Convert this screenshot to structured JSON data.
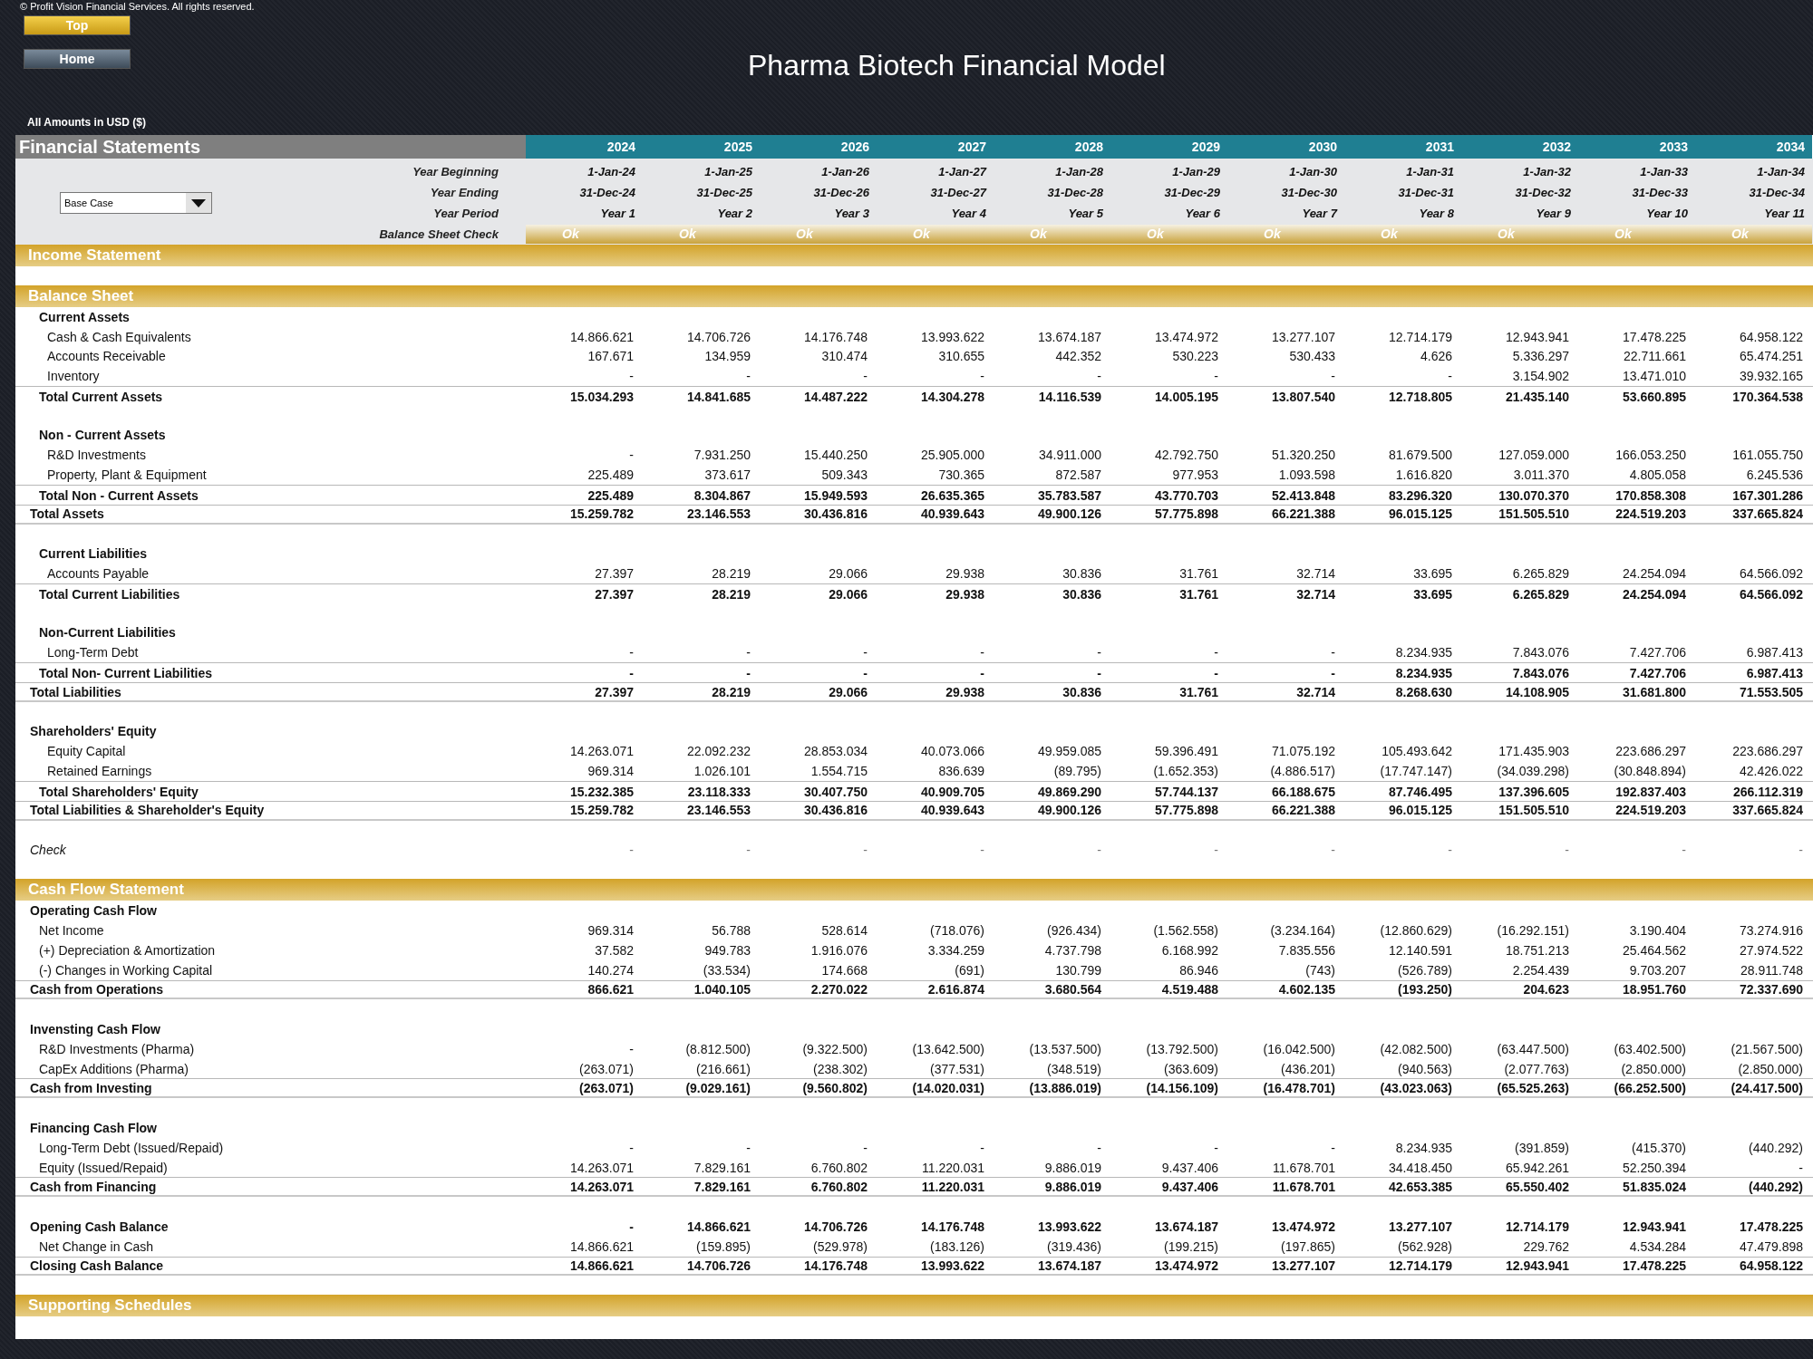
{
  "copyright": "© Profit Vision Financial Services. All rights reserved.",
  "buttons": [
    {
      "label": "Top",
      "kind": "gold"
    },
    {
      "label": "Home",
      "kind": "slate"
    }
  ],
  "title": "Pharma Biotech Financial Model",
  "currency_note": "All Amounts in USD ($)",
  "sheet_title": "Financial Statements",
  "years": [
    "2024",
    "2025",
    "2026",
    "2027",
    "2028",
    "2029",
    "2030",
    "2031",
    "2032",
    "2033",
    "2034"
  ],
  "scenario": {
    "value": "Base Case"
  },
  "info_rows": [
    {
      "label": "Year Beginning",
      "values": [
        "1-Jan-24",
        "1-Jan-25",
        "1-Jan-26",
        "1-Jan-27",
        "1-Jan-28",
        "1-Jan-29",
        "1-Jan-30",
        "1-Jan-31",
        "1-Jan-32",
        "1-Jan-33",
        "1-Jan-34"
      ]
    },
    {
      "label": "Year Ending",
      "values": [
        "31-Dec-24",
        "31-Dec-25",
        "31-Dec-26",
        "31-Dec-27",
        "31-Dec-28",
        "31-Dec-29",
        "31-Dec-30",
        "31-Dec-31",
        "31-Dec-32",
        "31-Dec-33",
        "31-Dec-34"
      ]
    },
    {
      "label": "Year Period",
      "values": [
        "Year 1",
        "Year 2",
        "Year 3",
        "Year 4",
        "Year 5",
        "Year 6",
        "Year 7",
        "Year 8",
        "Year 9",
        "Year 10",
        "Year 11"
      ]
    }
  ],
  "balance_check": {
    "label": "Balance Sheet Check",
    "values": [
      "Ok",
      "Ok",
      "Ok",
      "Ok",
      "Ok",
      "Ok",
      "Ok",
      "Ok",
      "Ok",
      "Ok",
      "Ok"
    ]
  },
  "sections": [
    {
      "title": "Income Statement",
      "gap_before": false
    },
    {
      "title": "Balance Sheet",
      "gap_before": true,
      "rows": [
        {
          "kind": "group",
          "label": "Current Assets",
          "gap_before": false
        },
        {
          "kind": "item",
          "label": "Cash & Cash Equivalents",
          "gap_before": false,
          "values": [
            "14.866.621",
            "14.706.726",
            "14.176.748",
            "13.993.622",
            "13.674.187",
            "13.474.972",
            "13.277.107",
            "12.714.179",
            "12.943.941",
            "17.478.225",
            "64.958.122"
          ]
        },
        {
          "kind": "item",
          "label": "Accounts Receivable",
          "gap_before": false,
          "values": [
            "167.671",
            "134.959",
            "310.474",
            "310.655",
            "442.352",
            "530.223",
            "530.433",
            "4.626",
            "5.336.297",
            "22.711.661",
            "65.474.251"
          ]
        },
        {
          "kind": "item",
          "label": "Inventory",
          "gap_before": false,
          "values": [
            "-",
            "-",
            "-",
            "-",
            "-",
            "-",
            "-",
            "-",
            "3.154.902",
            "13.471.010",
            "39.932.165"
          ]
        },
        {
          "kind": "subtotal",
          "label": "Total Current Assets",
          "gap_before": false,
          "values": [
            "15.034.293",
            "14.841.685",
            "14.487.222",
            "14.304.278",
            "14.116.539",
            "14.005.195",
            "13.807.540",
            "12.718.805",
            "21.435.140",
            "53.660.895",
            "170.364.538"
          ]
        },
        {
          "kind": "group",
          "label": "Non - Current Assets",
          "gap_before": true
        },
        {
          "kind": "item",
          "label": "R&D Investments",
          "gap_before": false,
          "values": [
            "-",
            "7.931.250",
            "15.440.250",
            "25.905.000",
            "34.911.000",
            "42.792.750",
            "51.320.250",
            "81.679.500",
            "127.059.000",
            "166.053.250",
            "161.055.750"
          ]
        },
        {
          "kind": "item",
          "label": "Property, Plant & Equipment",
          "gap_before": false,
          "values": [
            "225.489",
            "373.617",
            "509.343",
            "730.365",
            "872.587",
            "977.953",
            "1.093.598",
            "1.616.820",
            "3.011.370",
            "4.805.058",
            "6.245.536"
          ]
        },
        {
          "kind": "subtotal",
          "label": "Total Non - Current Assets",
          "gap_before": false,
          "values": [
            "225.489",
            "8.304.867",
            "15.949.593",
            "26.635.365",
            "35.783.587",
            "43.770.703",
            "52.413.848",
            "83.296.320",
            "130.070.370",
            "170.858.308",
            "167.301.286"
          ]
        },
        {
          "kind": "total",
          "label": "Total Assets",
          "gap_before": false,
          "values": [
            "15.259.782",
            "23.146.553",
            "30.436.816",
            "40.939.643",
            "49.900.126",
            "57.775.898",
            "66.221.388",
            "96.015.125",
            "151.505.510",
            "224.519.203",
            "337.665.824"
          ]
        },
        {
          "kind": "group",
          "label": "Current Liabilities",
          "gap_before": true
        },
        {
          "kind": "item",
          "label": "Accounts Payable",
          "gap_before": false,
          "values": [
            "27.397",
            "28.219",
            "29.066",
            "29.938",
            "30.836",
            "31.761",
            "32.714",
            "33.695",
            "6.265.829",
            "24.254.094",
            "64.566.092"
          ]
        },
        {
          "kind": "subtotal",
          "label": "Total Current Liabilities",
          "gap_before": false,
          "values": [
            "27.397",
            "28.219",
            "29.066",
            "29.938",
            "30.836",
            "31.761",
            "32.714",
            "33.695",
            "6.265.829",
            "24.254.094",
            "64.566.092"
          ]
        },
        {
          "kind": "group",
          "label": "Non-Current Liabilities",
          "gap_before": true
        },
        {
          "kind": "item",
          "label": "Long-Term Debt",
          "gap_before": false,
          "values": [
            "-",
            "-",
            "-",
            "-",
            "-",
            "-",
            "-",
            "8.234.935",
            "7.843.076",
            "7.427.706",
            "6.987.413"
          ]
        },
        {
          "kind": "subtotal",
          "label": "Total Non- Current Liabilities",
          "gap_before": false,
          "values": [
            "-",
            "-",
            "-",
            "-",
            "-",
            "-",
            "-",
            "8.234.935",
            "7.843.076",
            "7.427.706",
            "6.987.413"
          ]
        },
        {
          "kind": "total",
          "label": "Total Liabilities",
          "gap_before": false,
          "values": [
            "27.397",
            "28.219",
            "29.066",
            "29.938",
            "30.836",
            "31.761",
            "32.714",
            "8.268.630",
            "14.108.905",
            "31.681.800",
            "71.553.505"
          ]
        },
        {
          "kind": "heading",
          "label": "Shareholders' Equity",
          "gap_before": true
        },
        {
          "kind": "item",
          "label": "Equity Capital",
          "gap_before": false,
          "values": [
            "14.263.071",
            "22.092.232",
            "28.853.034",
            "40.073.066",
            "49.959.085",
            "59.396.491",
            "71.075.192",
            "105.493.642",
            "171.435.903",
            "223.686.297",
            "223.686.297"
          ]
        },
        {
          "kind": "item",
          "label": "Retained Earnings",
          "gap_before": false,
          "values": [
            "969.314",
            "1.026.101",
            "1.554.715",
            "836.639",
            "(89.795)",
            "(1.652.353)",
            "(4.886.517)",
            "(17.747.147)",
            "(34.039.298)",
            "(30.848.894)",
            "42.426.022"
          ]
        },
        {
          "kind": "subtotal",
          "label": "Total Shareholders' Equity",
          "gap_before": false,
          "values": [
            "15.232.385",
            "23.118.333",
            "30.407.750",
            "40.909.705",
            "49.869.290",
            "57.744.137",
            "66.188.675",
            "87.746.495",
            "137.396.605",
            "192.837.403",
            "266.112.319"
          ]
        },
        {
          "kind": "total",
          "label": "Total Liabilities & Shareholder's Equity",
          "gap_before": false,
          "values": [
            "15.259.782",
            "23.146.553",
            "30.436.816",
            "40.939.643",
            "49.900.126",
            "57.775.898",
            "66.221.388",
            "96.015.125",
            "151.505.510",
            "224.519.203",
            "337.665.824"
          ]
        },
        {
          "kind": "check",
          "label": "Check",
          "gap_before": true,
          "values": [
            "-",
            "-",
            "-",
            "-",
            "-",
            "-",
            "-",
            "-",
            "-",
            "-",
            "-"
          ]
        }
      ]
    },
    {
      "title": "Cash Flow Statement",
      "gap_before": true,
      "rows": [
        {
          "kind": "heading",
          "label": "Operating Cash Flow",
          "gap_before": false
        },
        {
          "kind": "line",
          "label": "Net Income",
          "gap_before": false,
          "values": [
            "969.314",
            "56.788",
            "528.614",
            "(718.076)",
            "(926.434)",
            "(1.562.558)",
            "(3.234.164)",
            "(12.860.629)",
            "(16.292.151)",
            "3.190.404",
            "73.274.916"
          ]
        },
        {
          "kind": "line",
          "label": "(+) Depreciation & Amortization",
          "gap_before": false,
          "values": [
            "37.582",
            "949.783",
            "1.916.076",
            "3.334.259",
            "4.737.798",
            "6.168.992",
            "7.835.556",
            "12.140.591",
            "18.751.213",
            "25.464.562",
            "27.974.522"
          ]
        },
        {
          "kind": "line",
          "label": "(-) Changes in Working Capital",
          "gap_before": false,
          "values": [
            "140.274",
            "(33.534)",
            "174.668",
            "(691)",
            "130.799",
            "86.946",
            "(743)",
            "(526.789)",
            "2.254.439",
            "9.703.207",
            "28.911.748"
          ]
        },
        {
          "kind": "total",
          "label": "Cash from Operations",
          "gap_before": false,
          "values": [
            "866.621",
            "1.040.105",
            "2.270.022",
            "2.616.874",
            "3.680.564",
            "4.519.488",
            "4.602.135",
            "(193.250)",
            "204.623",
            "18.951.760",
            "72.337.690"
          ]
        },
        {
          "kind": "heading",
          "label": "Invensting Cash Flow",
          "gap_before": true
        },
        {
          "kind": "line",
          "label": "R&D Investments (Pharma)",
          "gap_before": false,
          "values": [
            "-",
            "(8.812.500)",
            "(9.322.500)",
            "(13.642.500)",
            "(13.537.500)",
            "(13.792.500)",
            "(16.042.500)",
            "(42.082.500)",
            "(63.447.500)",
            "(63.402.500)",
            "(21.567.500)"
          ]
        },
        {
          "kind": "line",
          "label": "CapEx Additions (Pharma)",
          "gap_before": false,
          "values": [
            "(263.071)",
            "(216.661)",
            "(238.302)",
            "(377.531)",
            "(348.519)",
            "(363.609)",
            "(436.201)",
            "(940.563)",
            "(2.077.763)",
            "(2.850.000)",
            "(2.850.000)"
          ]
        },
        {
          "kind": "total",
          "label": "Cash from Investing",
          "gap_before": false,
          "values": [
            "(263.071)",
            "(9.029.161)",
            "(9.560.802)",
            "(14.020.031)",
            "(13.886.019)",
            "(14.156.109)",
            "(16.478.701)",
            "(43.023.063)",
            "(65.525.263)",
            "(66.252.500)",
            "(24.417.500)"
          ]
        },
        {
          "kind": "heading",
          "label": "Financing Cash Flow",
          "gap_before": true
        },
        {
          "kind": "line",
          "label": "Long-Term Debt (Issued/Repaid)",
          "gap_before": false,
          "values": [
            "-",
            "-",
            "-",
            "-",
            "-",
            "-",
            "-",
            "8.234.935",
            "(391.859)",
            "(415.370)",
            "(440.292)"
          ]
        },
        {
          "kind": "line",
          "label": "Equity (Issued/Repaid)",
          "gap_before": false,
          "values": [
            "14.263.071",
            "7.829.161",
            "6.760.802",
            "11.220.031",
            "9.886.019",
            "9.437.406",
            "11.678.701",
            "34.418.450",
            "65.942.261",
            "52.250.394",
            "-"
          ]
        },
        {
          "kind": "total",
          "label": "Cash from Financing",
          "gap_before": false,
          "values": [
            "14.263.071",
            "7.829.161",
            "6.760.802",
            "11.220.031",
            "9.886.019",
            "9.437.406",
            "11.678.701",
            "42.653.385",
            "65.550.402",
            "51.835.024",
            "(440.292)"
          ]
        },
        {
          "kind": "heading",
          "label": "Opening Cash Balance",
          "gap_before": true,
          "values": [
            "-",
            "14.866.621",
            "14.706.726",
            "14.176.748",
            "13.993.622",
            "13.674.187",
            "13.474.972",
            "13.277.107",
            "12.714.179",
            "12.943.941",
            "17.478.225"
          ]
        },
        {
          "kind": "line",
          "label": "Net Change in Cash",
          "gap_before": false,
          "values": [
            "14.866.621",
            "(159.895)",
            "(529.978)",
            "(183.126)",
            "(319.436)",
            "(199.215)",
            "(197.865)",
            "(562.928)",
            "229.762",
            "4.534.284",
            "47.479.898"
          ]
        },
        {
          "kind": "total",
          "label": "Closing Cash Balance",
          "gap_before": false,
          "values": [
            "14.866.621",
            "14.706.726",
            "14.176.748",
            "13.993.622",
            "13.674.187",
            "13.474.972",
            "13.277.107",
            "12.714.179",
            "12.943.941",
            "17.478.225",
            "64.958.122"
          ]
        }
      ]
    },
    {
      "title": "Supporting Schedules",
      "gap_before": true
    }
  ]
}
